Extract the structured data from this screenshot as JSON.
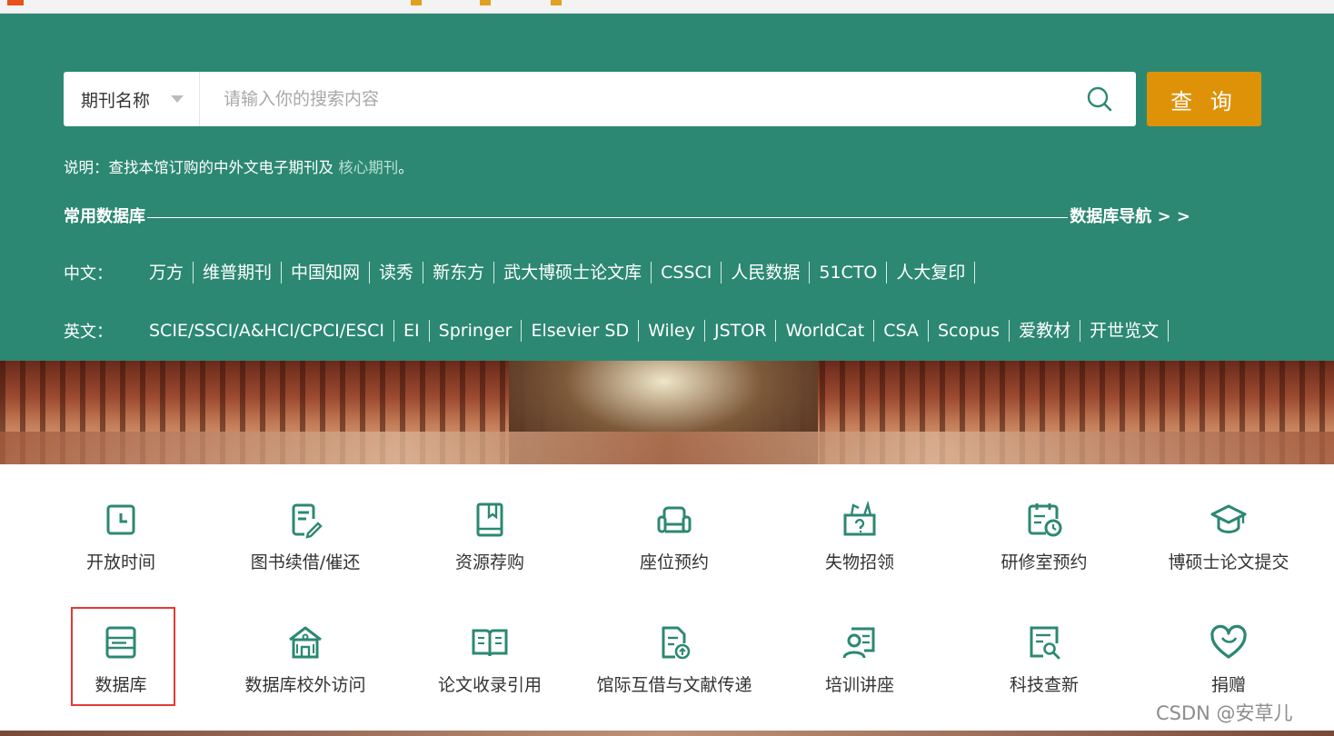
{
  "search": {
    "type_label": "期刊名称",
    "placeholder": "请输入你的搜索内容",
    "button_label": "查 询"
  },
  "note": {
    "text": "说明：查找本馆订购的中外文电子期刊及 ",
    "link": "核心期刊",
    "end": "。"
  },
  "databases": {
    "heading": "常用数据库",
    "nav_link": "数据库导航 > >",
    "chinese_label": "中文：",
    "chinese": [
      "万方",
      "维普期刊",
      "中国知网",
      "读秀",
      "新东方",
      "武大博硕士论文库",
      "CSSCI",
      "人民数据",
      "51CTO",
      "人大复印"
    ],
    "english_label": "英文：",
    "english": [
      "SCIE/SSCI/A&HCI/CPCI/ESCI",
      "EI",
      "Springer",
      "Elsevier SD",
      "Wiley",
      "JSTOR",
      "WorldCat",
      "CSA",
      "Scopus",
      "爱教材",
      "开世览文"
    ]
  },
  "services": [
    {
      "label": "开放时间",
      "icon": "clock-icon"
    },
    {
      "label": "图书续借/催还",
      "icon": "renew-document-icon"
    },
    {
      "label": "资源荐购",
      "icon": "book-icon"
    },
    {
      "label": "座位预约",
      "icon": "sofa-icon"
    },
    {
      "label": "失物招领",
      "icon": "lost-found-box-icon"
    },
    {
      "label": "研修室预约",
      "icon": "calendar-clock-icon"
    },
    {
      "label": "博硕士论文提交",
      "icon": "graduation-cap-icon"
    },
    {
      "label": "数据库",
      "icon": "database-icon"
    },
    {
      "label": "数据库校外访问",
      "icon": "building-icon"
    },
    {
      "label": "论文收录引用",
      "icon": "open-book-icon"
    },
    {
      "label": "馆际互借与文献传递",
      "icon": "document-upload-icon"
    },
    {
      "label": "培训讲座",
      "icon": "lecture-icon"
    },
    {
      "label": "科技查新",
      "icon": "search-document-icon"
    },
    {
      "label": "捐赠",
      "icon": "heart-icon"
    }
  ],
  "colors": {
    "panel": "#2c8872",
    "search_button": "#de9207",
    "icon": "#2c8872",
    "highlight": "#e53935"
  },
  "watermark": "CSDN @安草儿"
}
